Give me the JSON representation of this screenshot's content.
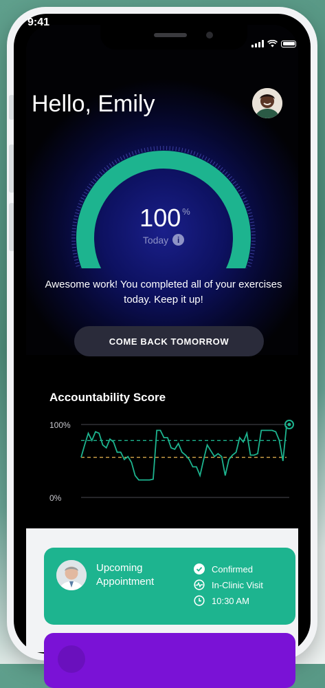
{
  "status_bar": {
    "time": "9:41"
  },
  "header": {
    "greeting": "Hello, Emily"
  },
  "progress": {
    "value": "100",
    "unit": "%",
    "label": "Today",
    "fraction": 1.0
  },
  "message": "Awesome work! You completed all of your exercises today. Keep it up!",
  "cta": {
    "label": "COME BACK TOMORROW"
  },
  "accountability": {
    "title": "Accountability Score",
    "y_top": "100%",
    "y_bottom": "0%"
  },
  "chart_data": {
    "type": "line",
    "title": "Accountability Score",
    "ylim": [
      0,
      100
    ],
    "ytick_labels": [
      "100%",
      "0%"
    ],
    "reference_lines": [
      {
        "value": 78,
        "color": "#1db48f",
        "style": "dashed"
      },
      {
        "value": 55,
        "color": "#d8a84a",
        "style": "dashed"
      }
    ],
    "series": [
      {
        "color": "#1db48f",
        "values": [
          55,
          72,
          88,
          78,
          90,
          88,
          72,
          68,
          80,
          76,
          62,
          62,
          52,
          56,
          48,
          30,
          24,
          24,
          24,
          24,
          25,
          92,
          92,
          82,
          82,
          68,
          66,
          74,
          62,
          58,
          52,
          42,
          42,
          30,
          52,
          72,
          64,
          56,
          60,
          56,
          30,
          52,
          58,
          62,
          82,
          76,
          88,
          58,
          58,
          60,
          92,
          92,
          92,
          92,
          90,
          78,
          50,
          98
        ]
      }
    ],
    "end_marker": {
      "value": 100
    },
    "colors": {
      "line": "#1db48f",
      "upper_ref": "#1db48f",
      "lower_ref": "#d8a84a"
    }
  },
  "appointment": {
    "title": "Upcoming Appointment",
    "status": "Confirmed",
    "visit_type": "In-Clinic Visit",
    "time": "10:30 AM"
  },
  "colors": {
    "accent": "#1db48f",
    "appointment_card": "#1db48f",
    "secondary_card": "#7a12d6",
    "button": "#2a2b3a"
  }
}
